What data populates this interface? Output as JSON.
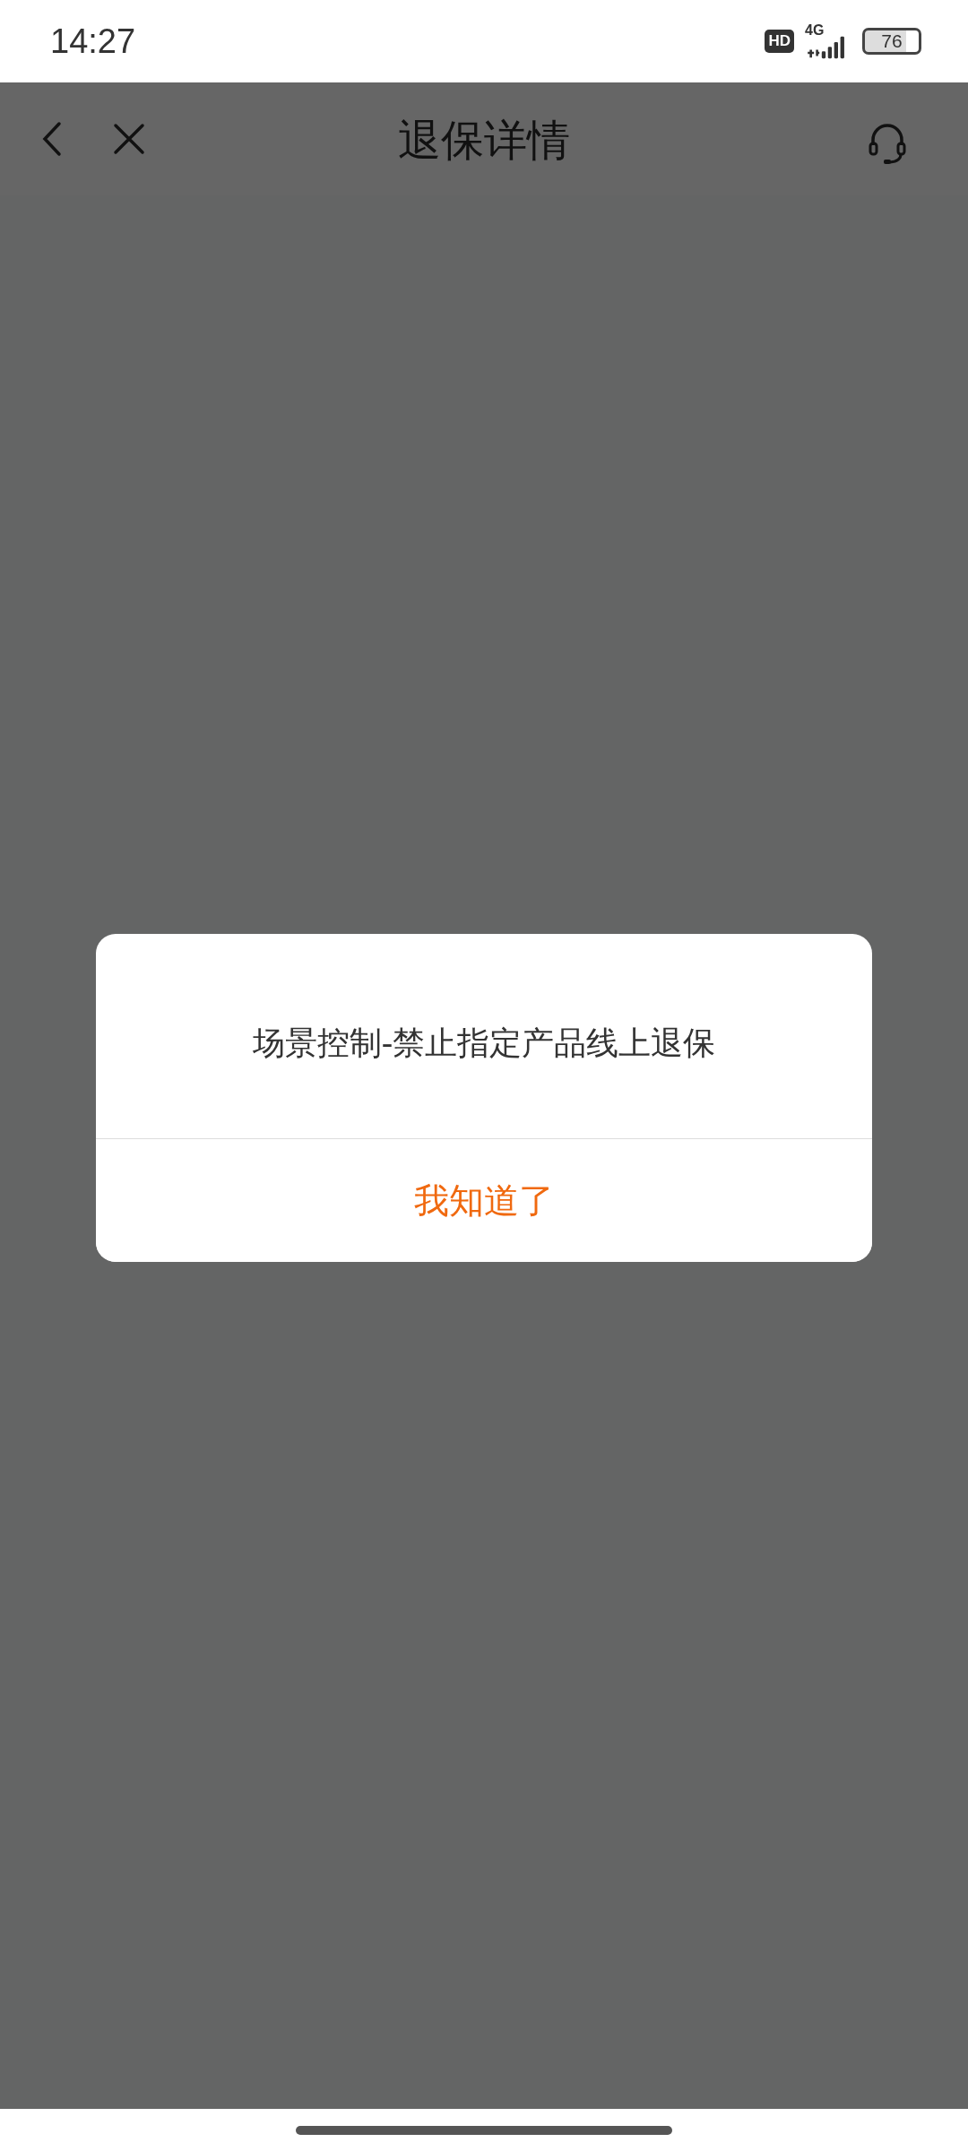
{
  "status_bar": {
    "time": "14:27",
    "hd_badge": "HD",
    "network": "4G",
    "battery": "76"
  },
  "header": {
    "title": "退保详情"
  },
  "dialog": {
    "message": "场景控制-禁止指定产品线上退保",
    "button": "我知道了"
  }
}
